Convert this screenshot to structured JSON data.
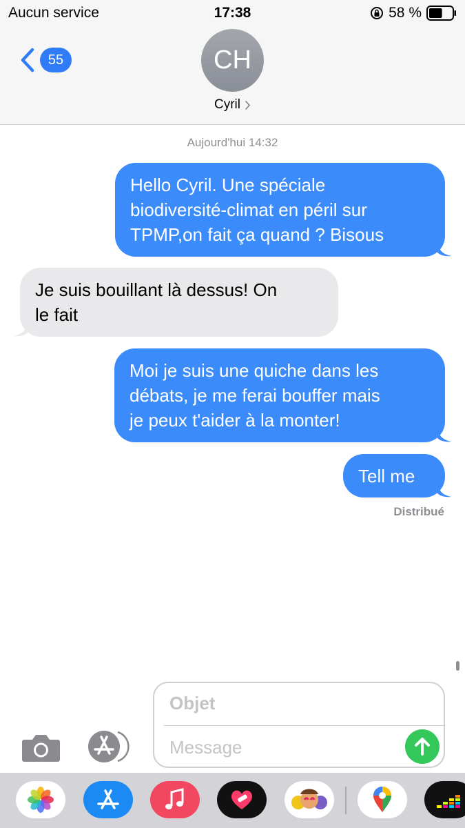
{
  "status_bar": {
    "carrier": "Aucun service",
    "time": "17:38",
    "battery": "58 %",
    "battery_level": 0.58
  },
  "header": {
    "back_count": "55",
    "avatar_initials": "CH",
    "contact_name": "Cyril"
  },
  "conversation": {
    "timestamp_day": "Aujourd'hui",
    "timestamp_time": "14:32",
    "messages": [
      {
        "direction": "sent",
        "lines": [
          "Hello Cyril. Une spéciale",
          "biodiversité-climat en péril sur",
          "TPMP,on fait ça quand ? Bisous"
        ]
      },
      {
        "direction": "received",
        "lines": [
          "Je suis bouillant là dessus! On",
          "le fait"
        ]
      },
      {
        "direction": "sent",
        "lines": [
          "Moi je suis une quiche dans les",
          "débats, je me ferai bouffer mais",
          "je peux t'aider à la monter!"
        ]
      },
      {
        "direction": "sent",
        "lines": [
          "Tell me"
        ]
      }
    ],
    "delivery_status": "Distribué"
  },
  "composer": {
    "subject_placeholder": "Objet",
    "message_placeholder": "Message"
  },
  "app_drawer": {
    "apps": [
      "photos-icon",
      "app-store-icon",
      "music-icon",
      "heart-sticker-icon",
      "memoji-icon",
      "google-maps-icon",
      "deezer-icon"
    ]
  },
  "colors": {
    "sent_bubble": "#3b8bfa",
    "received_bubble": "#e9e9eb",
    "accent": "#2f7cf6",
    "send_button": "#34c759"
  }
}
